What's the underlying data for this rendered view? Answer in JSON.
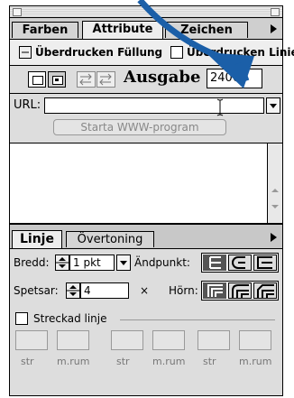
{
  "tabs": {
    "farben": "Farben",
    "attribute": "Attribute",
    "zeichen": "Zeichen"
  },
  "attr": {
    "fill_label": "Überdrucken Füllung",
    "line_label": "Überdrucken Linie",
    "ausgabe_label": "Ausgabe",
    "ausgabe_value": "2400",
    "url_label": "URL:",
    "url_value": "",
    "www_button": "Starta WWW-program"
  },
  "line_tabs": {
    "linje": "Linje",
    "overtoning": "Övertoning"
  },
  "line": {
    "bredd_label": "Bredd:",
    "bredd_value": "1 pkt",
    "andpunkt_label": "Ändpunkt:",
    "spetsar_label": "Spetsar:",
    "spetsar_value": "4",
    "x_label": "×",
    "horn_label": "Hörn:",
    "streckad_label": "Streckad linje",
    "dash_labels": [
      "str",
      "m.rum",
      "str",
      "m.rum",
      "str",
      "m.rum"
    ]
  },
  "colors": {
    "arrow": "#1b5fa8",
    "frame": "#000000",
    "panel": "#dddddd"
  }
}
